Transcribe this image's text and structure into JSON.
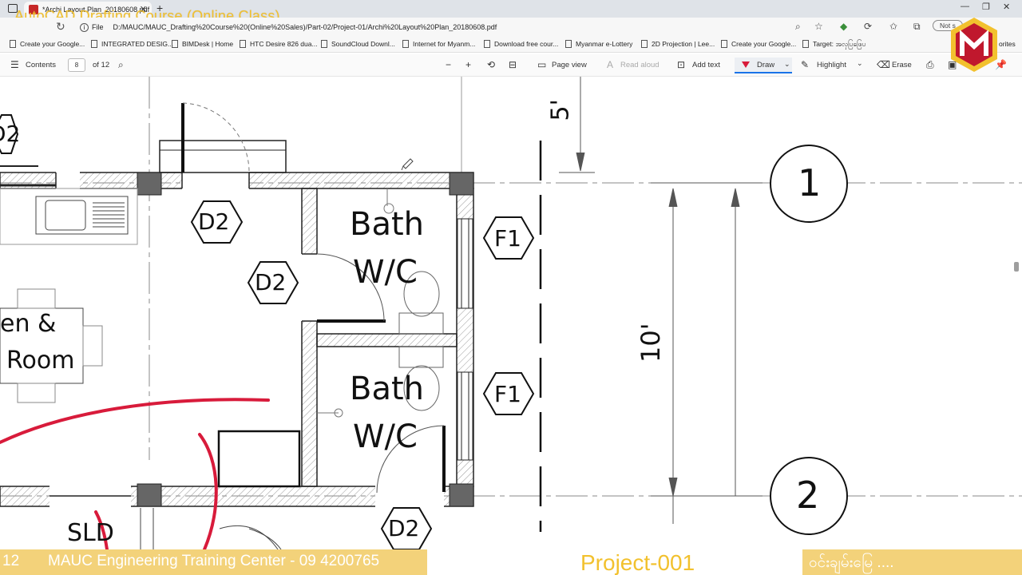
{
  "browser": {
    "tab_title": "*Archi Layout Plan_20180608.pdf",
    "overlay_title": "AutoCAD Drafting Course (Online Class)",
    "address_prefix": "File",
    "address_url": "D:/MAUC/MAUC_Drafting%20Course%20(Online%20Sales)/Part-02/Project-01/Archi%20Layout%20Plan_20180608.pdf",
    "not_label": "Not s",
    "bookmarks": [
      "Create your Google...",
      "INTEGRATED DESIG...",
      "BIMDesk | Home",
      "HTC Desire 826 dua...",
      "SoundCloud Downl...",
      "Internet for Myanm...",
      "Download free cour...",
      "Myanmar e-Lottery",
      "2D Projection | Lee...",
      "Create your Google...",
      "Target: အ​လှ​ပြ​ဖြေ​ပ",
      "orites"
    ]
  },
  "pdf_toolbar": {
    "contents": "Contents",
    "page_current": "8",
    "page_total": "of 12",
    "page_view": "Page view",
    "read_aloud": "Read aloud",
    "add_text": "Add text",
    "draw": "Draw",
    "highlight": "Highlight",
    "erase": "Erase"
  },
  "plan": {
    "rooms": [
      {
        "id": "bath1",
        "line1": "Bath",
        "line2": "W/C"
      },
      {
        "id": "bath2",
        "line1": "Bath",
        "line2": "W/C"
      }
    ],
    "kitchen_line1": "en &",
    "kitchen_line2": "Room",
    "sld": "SLD",
    "doors": [
      "D2",
      "D2",
      "D2",
      "D2"
    ],
    "windows": [
      "F1",
      "F1"
    ],
    "grid_labels": [
      "1",
      "2"
    ],
    "dimensions": [
      "5'",
      "10'"
    ]
  },
  "footer": {
    "left_number": "12",
    "center_text": "MAUC Engineering Training Center - 09 4200765",
    "project": "Project-001",
    "right_text": "ဝင်းချမ်းမြေ ...."
  },
  "colors": {
    "accent_yellow": "#f2c12e",
    "footer_band": "#f3d27a",
    "markup_red": "#d81b3b",
    "logo_red": "#c0182d"
  }
}
